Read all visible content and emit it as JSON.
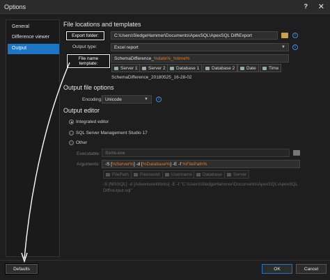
{
  "window": {
    "title": "Options",
    "help_label": "?",
    "close_label": "✕"
  },
  "sidebar": {
    "items": [
      {
        "label": "General"
      },
      {
        "label": "Difference viewer"
      },
      {
        "label": "Output"
      }
    ]
  },
  "file_section": {
    "heading": "File locations and templates",
    "export_folder_label": "Export folder:",
    "export_folder_value": "C:\\Users\\SledgeHammer\\Documents\\ApexSQL\\ApexSQL Diff\\Export",
    "output_type_label": "Output type:",
    "output_type_value": "Excel report",
    "template_label": "File name template:",
    "template_prefix": "SchemaDifference_",
    "template_tokens": "%date%_%time%",
    "tokens": [
      "Server 1",
      "Server 2",
      "Database 1",
      "Database 2",
      "Date",
      "Time"
    ],
    "preview": "SchemaDifference_20180525_16-28-02"
  },
  "file_options": {
    "heading": "Output file options",
    "encoding_label": "Encoding:",
    "encoding_value": "Unicode"
  },
  "editor": {
    "heading": "Output editor",
    "options": [
      "Integrated editor",
      "SQL Server Management Studio 17",
      "Other"
    ],
    "executable_label": "Executable:",
    "executable_value": "Ssms.exe",
    "arguments_label": "Arguments:",
    "arguments_parts": [
      "-S [",
      "%Server%",
      "] -d [",
      "%Database%",
      "] -E -f ",
      "%FilePath%"
    ],
    "tokens": [
      "FilePath",
      "Password",
      "Username",
      "Database",
      "Server"
    ],
    "preview_line1": "-S [MSSQL] -d [AdventureWorks] -E -f \"C:\\Users\\SledgeHammer\\Documents\\ApexSQL\\ApexSQL",
    "preview_line2": "Diff\\output.sql\""
  },
  "footer": {
    "defaults_label": "Defaults",
    "ok_label": "OK",
    "cancel_label": "Cancel"
  },
  "colors": {
    "accent": "#1e74c5",
    "token": "#e07b2c",
    "annotation": "#ffffff"
  }
}
